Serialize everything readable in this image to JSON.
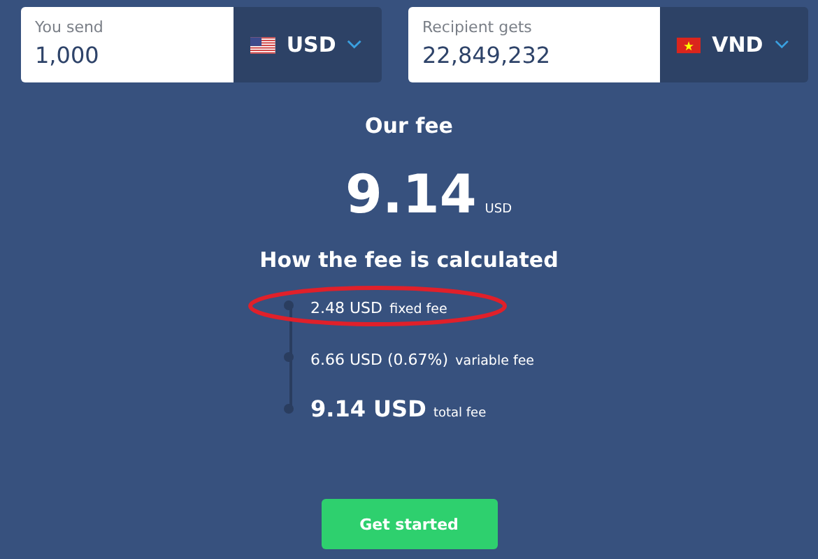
{
  "converter": [
    {
      "label": "You send",
      "value": "1,000",
      "currency": "USD"
    },
    {
      "label": "Recipient gets",
      "value": "22,849,232",
      "currency": "VND"
    }
  ],
  "fee": {
    "title": "Our fee",
    "amount": "9.14",
    "currency": "USD"
  },
  "breakdown": {
    "title": "How the fee is calculated",
    "items": [
      {
        "kind": "part",
        "amount": "2.48 USD",
        "label": "fixed fee",
        "highlighted": true
      },
      {
        "kind": "part",
        "amount": "6.66 USD (0.67%)",
        "label": "variable fee",
        "highlighted": false
      },
      {
        "kind": "total",
        "amount": "9.14 USD",
        "label": "total fee",
        "highlighted": false
      }
    ]
  },
  "cta": "Get started"
}
